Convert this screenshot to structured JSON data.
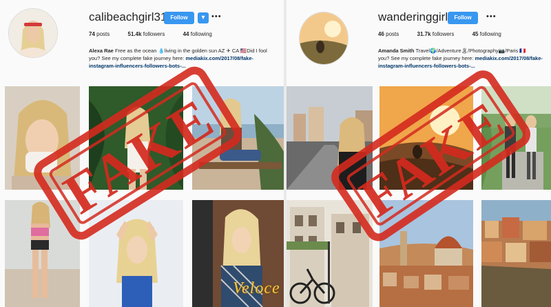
{
  "left_profile": {
    "username": "calibeachgirl310",
    "follow_label": "Follow",
    "dropdown_icon": "chevron-down-icon",
    "more_icon": "ellipsis-icon",
    "posts_count": "74",
    "posts_label": "posts",
    "followers_count": "51.4k",
    "followers_label": "followers",
    "following_count": "44",
    "following_label": "following",
    "bio_name": "Alexa Rae",
    "bio_line1": " Free as the ocean 💧living in the golden sun AZ ✈ CA 🇺🇸Did I fool",
    "bio_line2": "you? See my complete fake journey here: ",
    "bio_link_a": "mediakix.com/2017/08/fake-",
    "bio_link_b": "instagram-influencers-followers-bots-..."
  },
  "right_profile": {
    "username": "wanderinggirl",
    "follow_label": "Follow",
    "more_icon": "ellipsis-icon",
    "posts_count": "46",
    "posts_label": "posts",
    "followers_count": "31.7k",
    "followers_label": "followers",
    "following_count": "45",
    "following_label": "following",
    "bio_name": "Amanda Smith",
    "bio_line1": " Travel🌍/Adventure🏝/Photography📷/Paris 🇫🇷",
    "bio_line2": "you? See my complete fake journey here: ",
    "bio_link_a": "mediakix.com/2017/08/fake-",
    "bio_link_b": "instagram-influencers-followers-bots-..."
  },
  "stamp_text": "FAKE",
  "watermark_text": "Veloce",
  "colors": {
    "follow_blue": "#3897f0",
    "stamp_red": "#d42a1e",
    "background": "#fafafa",
    "watermark_gold": "#f5c542"
  }
}
